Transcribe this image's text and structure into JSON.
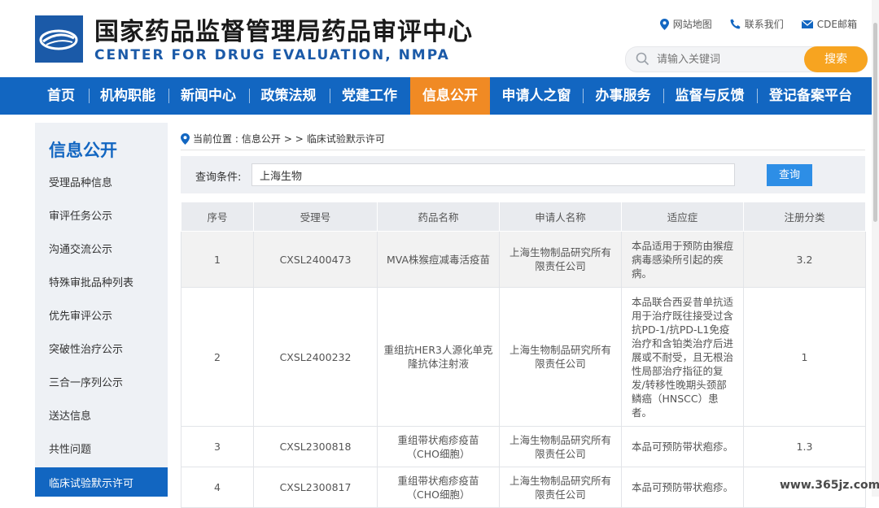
{
  "header": {
    "title_cn": "国家药品监督管理局药品审评中心",
    "title_en": "CENTER FOR DRUG EVALUATION, NMPA",
    "links": [
      {
        "label": "网站地图",
        "icon": "location-pin-icon"
      },
      {
        "label": "联系我们",
        "icon": "phone-icon"
      },
      {
        "label": "CDE邮箱",
        "icon": "mail-icon"
      }
    ],
    "search_placeholder": "请输入关键词",
    "search_button": "搜索"
  },
  "nav": {
    "items": [
      "首页",
      "机构职能",
      "新闻中心",
      "政策法规",
      "党建工作",
      "信息公开",
      "申请人之窗",
      "办事服务",
      "监督与反馈",
      "登记备案平台"
    ],
    "active": "信息公开"
  },
  "sidebar": {
    "title": "信息公开",
    "items": [
      "受理品种信息",
      "审评任务公示",
      "沟通交流公示",
      "特殊审批品种列表",
      "优先审评公示",
      "突破性治疗公示",
      "三合一序列公示",
      "送达信息",
      "共性问题",
      "临床试验默示许可"
    ],
    "active": "临床试验默示许可"
  },
  "breadcrumb": {
    "prefix": "当前位置 :",
    "section": "信息公开",
    "sep": "> >",
    "current": "临床试验默示许可"
  },
  "query": {
    "label": "查询条件:",
    "value": "上海生物",
    "button": "查询"
  },
  "table": {
    "headers": [
      "序号",
      "受理号",
      "药品名称",
      "申请人名称",
      "适应症",
      "注册分类"
    ],
    "rows": [
      {
        "no": "1",
        "accept_no": "CXSL2400473",
        "drug": "MVA株猴痘减毒活疫苗",
        "applicant": "上海生物制品研究所有限责任公司",
        "indication": "本品适用于预防由猴痘病毒感染所引起的疾病。",
        "category": "3.2"
      },
      {
        "no": "2",
        "accept_no": "CXSL2400232",
        "drug": "重组抗HER3人源化单克隆抗体注射液",
        "applicant": "上海生物制品研究所有限责任公司",
        "indication": "本品联合西妥昔单抗适用于治疗既往接受过含抗PD-1/抗PD-L1免疫治疗和含铂类治疗后进展或不耐受，且无根治性局部治疗指征的复发/转移性晚期头颈部鳞癌（HNSCC）患者。",
        "category": "1"
      },
      {
        "no": "3",
        "accept_no": "CXSL2300818",
        "drug": "重组带状疱疹疫苗（CHO细胞）",
        "applicant": "上海生物制品研究所有限责任公司",
        "indication": "本品可预防带状疱疹。",
        "category": "1.3"
      },
      {
        "no": "4",
        "accept_no": "CXSL2300817",
        "drug": "重组带状疱疹疫苗（CHO细胞）",
        "applicant": "上海生物制品研究所有限责任公司",
        "indication": "本品可预防带状疱疹。",
        "category": ""
      }
    ]
  },
  "watermark": "www.365jz.com",
  "colors": {
    "brand_blue": "#1266c1",
    "accent_orange": "#f08a24",
    "search_orange": "#f7a420",
    "query_blue": "#2d8ee6"
  }
}
